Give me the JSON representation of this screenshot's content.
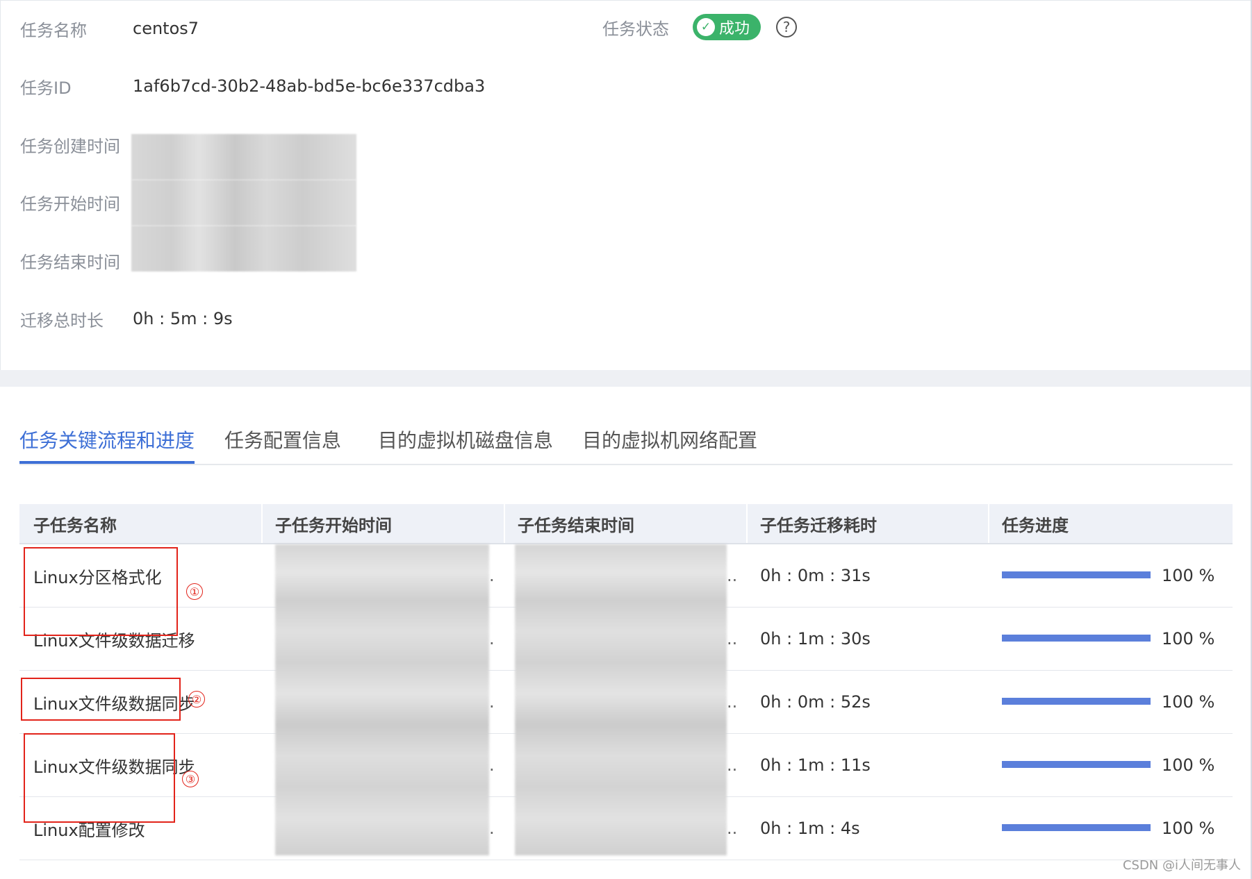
{
  "task_info": {
    "name_label": "任务名称",
    "name_value": "centos7",
    "status_label": "任务状态",
    "status_value": "成功",
    "status_color": "#3bb36a",
    "id_label": "任务ID",
    "id_value": "1af6b7cd-30b2-48ab-bd5e-bc6e337cdba3",
    "created_label": "任务创建时间",
    "start_label": "任务开始时间",
    "end_label": "任务结束时间",
    "duration_label": "迁移总时长",
    "duration_value": "0h : 5m : 9s"
  },
  "tabs": [
    {
      "label": "任务关键流程和进度",
      "active": true
    },
    {
      "label": "任务配置信息",
      "active": false
    },
    {
      "label": "目的虚拟机磁盘信息",
      "active": false
    },
    {
      "label": "目的虚拟机网络配置",
      "active": false
    }
  ],
  "table": {
    "headers": [
      "子任务名称",
      "子任务开始时间",
      "子任务结束时间",
      "子任务迁移耗时",
      "任务进度"
    ],
    "rows": [
      {
        "name": "Linux分区格式化",
        "start_suffix": ".",
        "end_suffix": "..",
        "duration": "0h : 0m : 31s",
        "progress": 100,
        "progress_text": "100 %"
      },
      {
        "name": "Linux文件级数据迁移",
        "start_suffix": ".",
        "end_suffix": "..",
        "duration": "0h : 1m : 30s",
        "progress": 100,
        "progress_text": "100 %"
      },
      {
        "name": "Linux文件级数据同步",
        "start_suffix": ".",
        "end_suffix": "..",
        "duration": "0h : 0m : 52s",
        "progress": 100,
        "progress_text": "100 %"
      },
      {
        "name": "Linux文件级数据同步",
        "start_suffix": ".",
        "end_suffix": "..",
        "duration": "0h : 1m : 11s",
        "progress": 100,
        "progress_text": "100 %"
      },
      {
        "name": "Linux配置修改",
        "start_suffix": ".",
        "end_suffix": "..",
        "duration": "0h : 1m : 4s",
        "progress": 100,
        "progress_text": "100 %"
      }
    ]
  },
  "annotations": {
    "marker1": "①",
    "marker2": "②",
    "marker3": "③"
  },
  "watermark": "CSDN @i人间无事人"
}
